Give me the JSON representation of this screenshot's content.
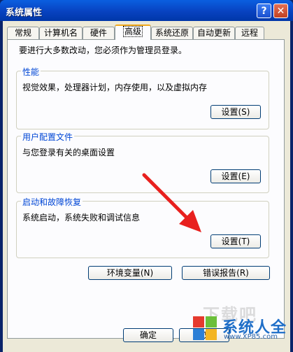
{
  "window": {
    "title": "系统属性",
    "help_icon": "?",
    "close_icon": "✕"
  },
  "tabs": [
    {
      "label": "常规",
      "active": false
    },
    {
      "label": "计算机名",
      "active": false
    },
    {
      "label": "硬件",
      "active": false
    },
    {
      "label": "高级",
      "active": true
    },
    {
      "label": "系统还原",
      "active": false
    },
    {
      "label": "自动更新",
      "active": false
    },
    {
      "label": "远程",
      "active": false
    }
  ],
  "intro": "要进行大多数改动，您必须作为管理员登录。",
  "performance": {
    "title": "性能",
    "desc": "视觉效果，处理器计划，内存使用，以及虚拟内存",
    "button": "设置(S)"
  },
  "user_profiles": {
    "title": "用户配置文件",
    "desc": "与您登录有关的桌面设置",
    "button": "设置(E)"
  },
  "startup_recovery": {
    "title": "启动和故障恢复",
    "desc": "系统启动，系统失败和调试信息",
    "button": "设置(T)"
  },
  "bottom_buttons": {
    "env": "环境变量(N)",
    "error": "错误报告(R)"
  },
  "dialog_buttons": {
    "ok": "确定",
    "cancel": "取"
  },
  "watermark": {
    "ghost": "下载吧",
    "brand": "系统人全",
    "url": "www.XP85.com"
  },
  "colors": {
    "titlebar": "#0842C0",
    "group_title": "#0046D5",
    "arrow": "#E8201E"
  }
}
